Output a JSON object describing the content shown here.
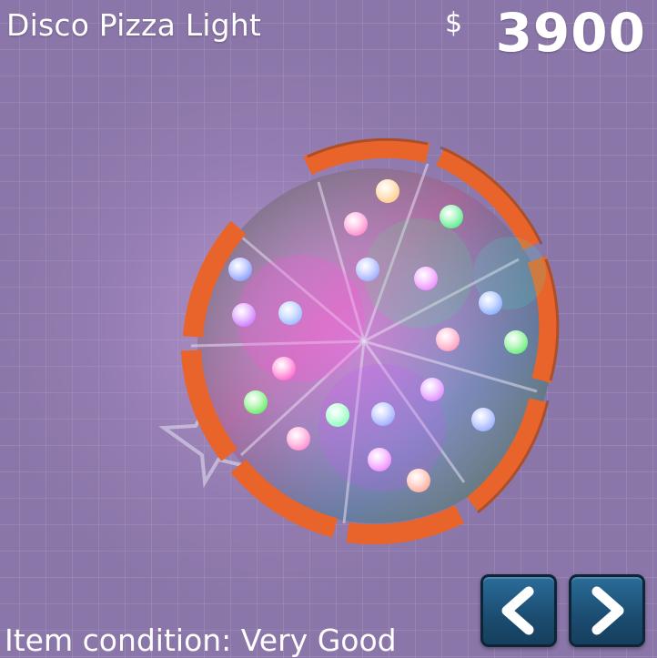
{
  "item": {
    "name": "Disco Pizza Light",
    "currency_symbol": "$",
    "price": "3900",
    "condition_text": "Item condition: Very Good"
  },
  "navigation": {
    "prev_icon": "chevron-left-icon",
    "next_icon": "chevron-right-icon"
  },
  "colors": {
    "background": "#8a76a8",
    "crust": "#e8642a",
    "button": "#1f5680",
    "text": "#ffffff"
  }
}
